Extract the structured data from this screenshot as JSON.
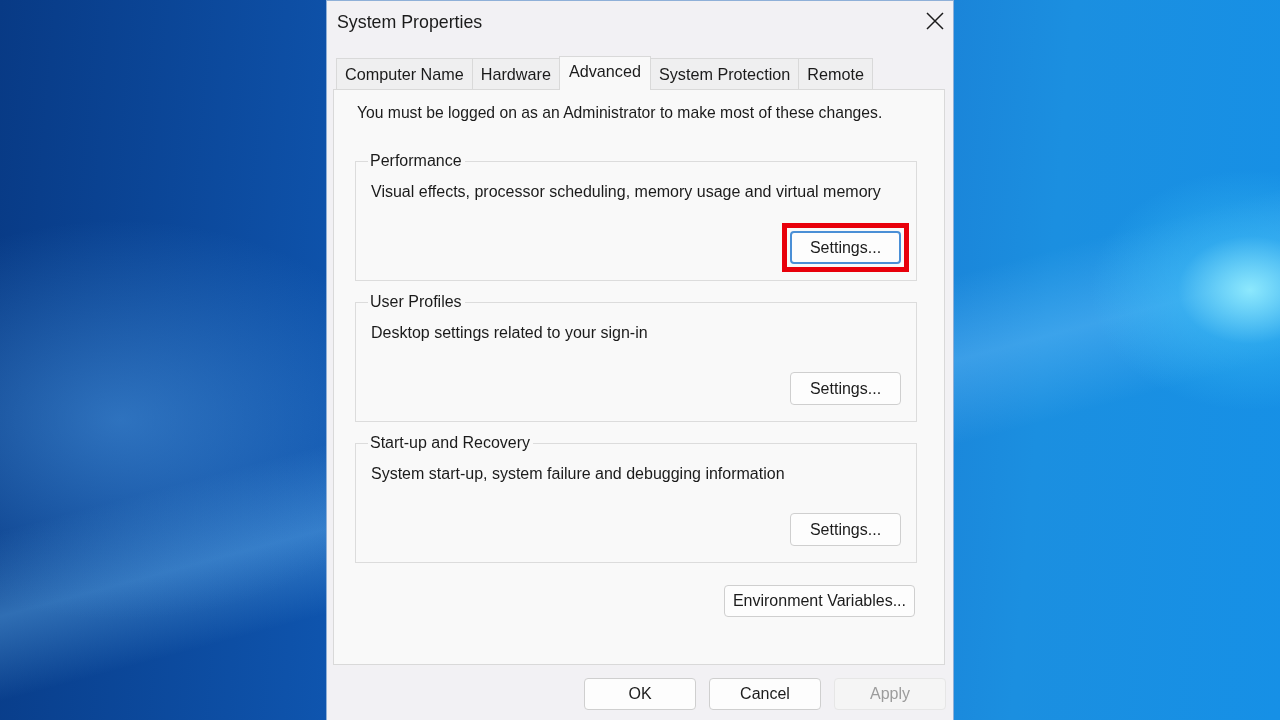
{
  "window": {
    "title": "System Properties"
  },
  "tabs": [
    {
      "label": "Computer Name",
      "selected": false
    },
    {
      "label": "Hardware",
      "selected": false
    },
    {
      "label": "Advanced",
      "selected": true
    },
    {
      "label": "System Protection",
      "selected": false
    },
    {
      "label": "Remote",
      "selected": false
    }
  ],
  "notice": "You must be logged on as an Administrator to make most of these changes.",
  "groups": [
    {
      "title": "Performance",
      "description": "Visual effects, processor scheduling, memory usage and virtual memory",
      "button": {
        "label": "Settings...",
        "focused": true,
        "highlighted": true
      }
    },
    {
      "title": "User Profiles",
      "description": "Desktop settings related to your sign-in",
      "button": {
        "label": "Settings...",
        "focused": false,
        "highlighted": false
      }
    },
    {
      "title": "Start-up and Recovery",
      "description": "System start-up, system failure and debugging information",
      "button": {
        "label": "Settings...",
        "focused": false,
        "highlighted": false
      }
    }
  ],
  "environment_button": {
    "label": "Environment Variables..."
  },
  "buttons": [
    {
      "label": "OK",
      "disabled": false
    },
    {
      "label": "Cancel",
      "disabled": false
    },
    {
      "label": "Apply",
      "disabled": true
    }
  ]
}
